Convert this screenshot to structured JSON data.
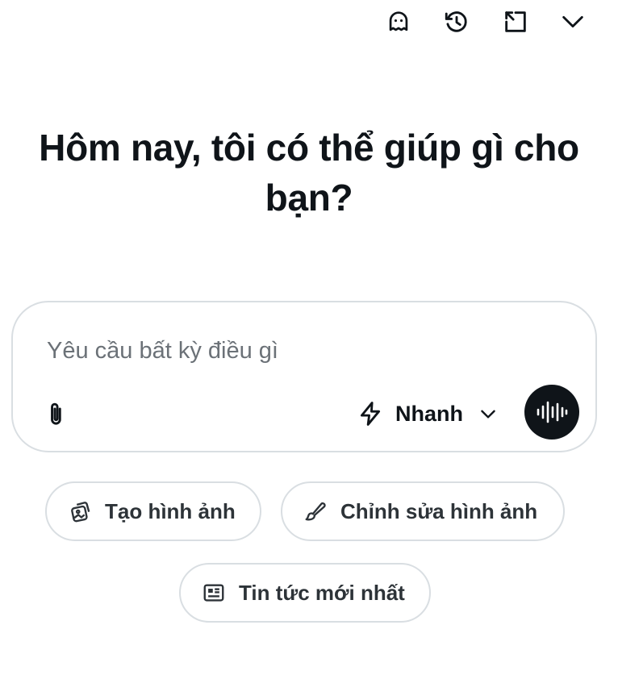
{
  "header": {
    "icons": [
      "ghost-icon",
      "history-icon",
      "collapse-icon",
      "chevron-down-icon"
    ]
  },
  "headline": {
    "line1": "Hôm nay, tôi có thể giúp gì cho",
    "line2": "bạn?"
  },
  "composer": {
    "placeholder": "Yêu cầu bất kỳ điều gì",
    "value": "",
    "mode_label": "Nhanh",
    "attach_icon": "paperclip-icon",
    "mode_icon": "lightning-icon",
    "voice_icon": "voice-waveform-icon"
  },
  "suggestions": [
    {
      "label": "Tạo hình ảnh",
      "icon": "image-stack-icon"
    },
    {
      "label": "Chỉnh sửa hình ảnh",
      "icon": "brush-icon"
    },
    {
      "label": "Tin tức mới nhất",
      "icon": "newspaper-icon"
    }
  ],
  "colors": {
    "text": "#0f1419",
    "muted": "#6b7177",
    "border": "#d9dee2",
    "voice_button": "#0f1419"
  }
}
